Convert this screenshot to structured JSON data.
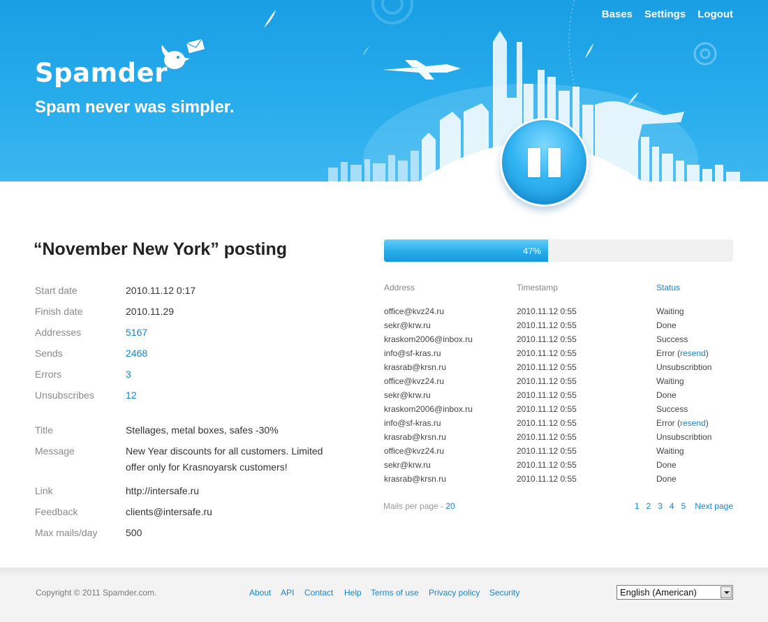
{
  "brand": {
    "logo_text": "Spamder",
    "tagline": "Spam never was simpler."
  },
  "nav": {
    "items": [
      "Bases",
      "Settings",
      "Logout"
    ]
  },
  "colors": {
    "header_blue": "#27acec",
    "link_blue": "#1a84c6",
    "progress_blue": "#27ace9"
  },
  "posting": {
    "title": "“November New York” posting",
    "details": [
      {
        "label": "Start date",
        "value": "2010.11.12 0:17",
        "link": false
      },
      {
        "label": "Finish date",
        "value": "2010.11.29",
        "link": false
      },
      {
        "label": "Addresses",
        "value": "5167",
        "link": true
      },
      {
        "label": "Sends",
        "value": "2468",
        "link": true
      },
      {
        "label": "Errors",
        "value": "3",
        "link": true
      },
      {
        "label": "Unsubscribes",
        "value": "12",
        "link": true
      }
    ],
    "message_details": [
      {
        "label": "Title",
        "value": "Stellages, metal boxes, safes -30%"
      },
      {
        "label": "Message",
        "value": "New Year discounts for all customers. Limited offer only for Krasnoyarsk customers!"
      },
      {
        "label": "Link",
        "value": "http://intersafe.ru"
      },
      {
        "label": "Feedback",
        "value": "clients@intersafe.ru"
      },
      {
        "label": "Max mails/day",
        "value": "500"
      }
    ]
  },
  "progress": {
    "percent": 47,
    "label": "47%"
  },
  "mails": {
    "columns": [
      "Address",
      "Timestamp",
      "Status"
    ],
    "rows": [
      {
        "address": "office@kvz24.ru",
        "timestamp": "2010.11.12 0:55",
        "status": "Waiting"
      },
      {
        "address": "sekr@krw.ru",
        "timestamp": "2010.11.12 0:55",
        "status": "Done"
      },
      {
        "address": "kraskom2006@inbox.ru",
        "timestamp": "2010.11.12 0:55",
        "status": "Success"
      },
      {
        "address": "info@sf-kras.ru",
        "timestamp": "2010.11.12 0:55",
        "status": "Error",
        "resend": "resend"
      },
      {
        "address": "krasrab@krsn.ru",
        "timestamp": "2010.11.12 0:55",
        "status": "Unsubscribtion"
      },
      {
        "address": "office@kvz24.ru",
        "timestamp": "2010.11.12 0:55",
        "status": "Waiting"
      },
      {
        "address": "sekr@krw.ru",
        "timestamp": "2010.11.12 0:55",
        "status": "Done"
      },
      {
        "address": "kraskom2006@inbox.ru",
        "timestamp": "2010.11.12 0:55",
        "status": "Success"
      },
      {
        "address": "info@sf-kras.ru",
        "timestamp": "2010.11.12 0:55",
        "status": "Error",
        "resend": "resend"
      },
      {
        "address": "krasrab@krsn.ru",
        "timestamp": "2010.11.12 0:55",
        "status": "Unsubscribtion"
      },
      {
        "address": "office@kvz24.ru",
        "timestamp": "2010.11.12 0:55",
        "status": "Waiting"
      },
      {
        "address": "sekr@krw.ru",
        "timestamp": "2010.11.12 0:55",
        "status": "Done"
      },
      {
        "address": "krasrab@krsn.ru",
        "timestamp": "2010.11.12 0:55",
        "status": "Done"
      }
    ],
    "per_page_label": "Mails per page - ",
    "per_page_value": "20",
    "pages": [
      "1",
      "2",
      "3",
      "4",
      "5"
    ],
    "next_label": "Next page"
  },
  "footer": {
    "copyright": "Copyright © 2011 Spamder.com.",
    "links": [
      "About",
      "API",
      "Contact",
      "Help",
      "Terms of use",
      "Privacy policy",
      "Security"
    ],
    "language": "English (American)"
  }
}
